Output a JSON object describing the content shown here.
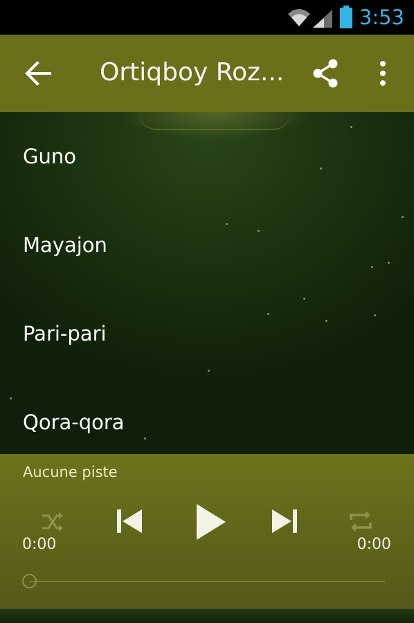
{
  "status_bar": {
    "time": "3:53",
    "icons": [
      "wifi-icon",
      "signal-icon",
      "battery-icon"
    ],
    "clock_color": "#33b5e5"
  },
  "action_bar": {
    "title": "Ortiqboy Roz...",
    "icons": [
      "back-arrow-icon",
      "share-icon",
      "overflow-menu-icon"
    ],
    "color": "#6b6f1a"
  },
  "tracks": [
    {
      "label": "Guno"
    },
    {
      "label": "Mayajon"
    },
    {
      "label": "Pari-pari"
    },
    {
      "label": "Qora-qora"
    }
  ],
  "player": {
    "track_status": "Aucune piste",
    "elapsed": "0:00",
    "total": "0:00",
    "progress": 0,
    "controls": [
      "shuffle-icon",
      "previous-icon",
      "play-icon",
      "next-icon",
      "repeat-icon"
    ],
    "panel_color": "#6d721b"
  }
}
